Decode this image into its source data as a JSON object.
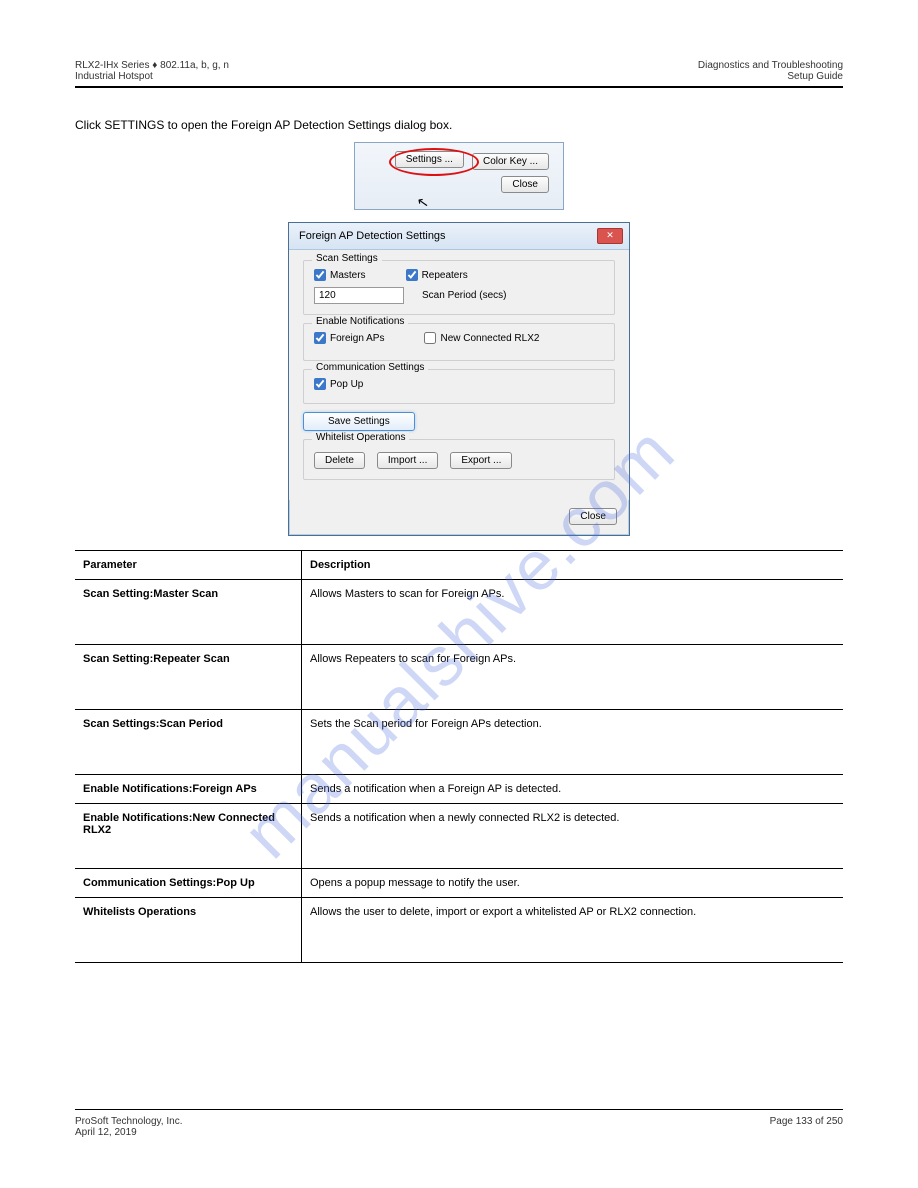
{
  "header": {
    "left_top": "RLX2-IHx Series ♦ 802.11a, b, g, n",
    "left_bottom": "Industrial Hotspot",
    "right_top": "Diagnostics and Troubleshooting",
    "right_bottom": "Setup Guide"
  },
  "intro": "Click SETTINGS to open the Foreign AP Detection Settings dialog box.",
  "toolbar": {
    "settings": "Settings ...",
    "colorkey": "Color Key ...",
    "close": "Close"
  },
  "dialog": {
    "title": "Foreign AP Detection Settings",
    "scan_group": "Scan Settings",
    "masters": "Masters",
    "repeaters": "Repeaters",
    "scan_period_value": "120",
    "scan_period_label": "Scan Period (secs)",
    "enable_group": "Enable Notifications",
    "foreign_aps": "Foreign APs",
    "new_rlx2": "New Connected RLX2",
    "comm_group": "Communication Settings",
    "popup": "Pop Up",
    "save": "Save Settings",
    "whitelist_group": "Whitelist Operations",
    "delete": "Delete",
    "import": "Import ...",
    "export": "Export ...",
    "close": "Close"
  },
  "table": {
    "h1": "Parameter",
    "h2": "Description",
    "rows": [
      {
        "p": "Scan Setting:Master Scan",
        "d": "Allows Masters to scan for Foreign APs.",
        "multi": true
      },
      {
        "p": "Scan Setting:Repeater Scan",
        "d": "Allows Repeaters to scan for Foreign APs.",
        "multi": true
      },
      {
        "p": "Scan Settings:Scan Period",
        "d": "Sets the Scan period for Foreign APs detection.",
        "multi": true
      },
      {
        "p": "Enable Notifications:Foreign APs",
        "d": "Sends a notification when a Foreign AP is detected.",
        "multi": false
      },
      {
        "p": "Enable Notifications:New Connected RLX2",
        "d": "Sends a notification when a newly connected RLX2 is detected.",
        "multi": true
      },
      {
        "p": "Communication Settings:Pop Up",
        "d": "Opens a popup message to notify the user.",
        "multi": false
      },
      {
        "p": "Whitelists Operations",
        "d": "Allows the user to delete, import or export a whitelisted AP or RLX2 connection.",
        "multi": true
      }
    ]
  },
  "footer": {
    "left_top": "ProSoft Technology, Inc.",
    "left_bottom": "April 12, 2019",
    "right": "Page 133 of 250"
  },
  "watermark": "manualshive.com"
}
